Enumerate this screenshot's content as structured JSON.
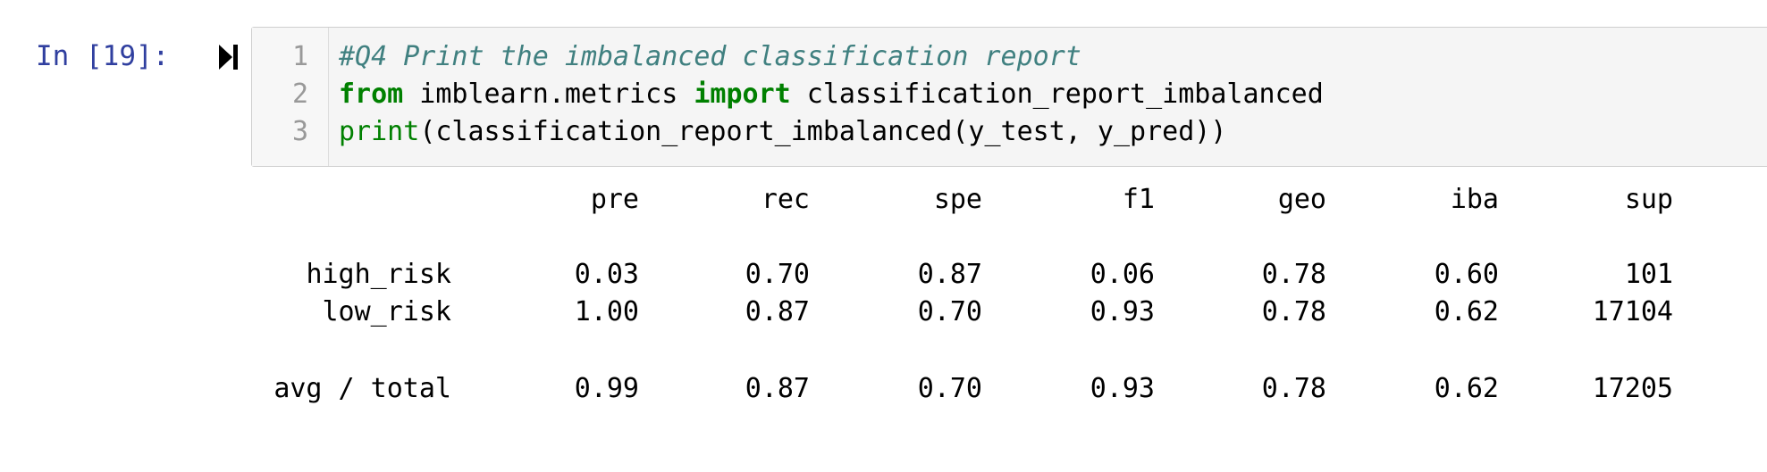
{
  "cell": {
    "prompt": "In [19]:",
    "code_lines": [
      {
        "num": "1",
        "comment": "#Q4 Print the imbalanced classification report"
      },
      {
        "num": "2",
        "kw_from": "from",
        "module": " imblearn.metrics ",
        "kw_import": "import",
        "name": " classification_report_imbalanced"
      },
      {
        "num": "3",
        "builtin": "print",
        "rest": "(classification_report_imbalanced(y_test, y_pred))"
      }
    ]
  },
  "output": {
    "headers": [
      "pre",
      "rec",
      "spe",
      "f1",
      "geo",
      "iba",
      "sup"
    ],
    "rows": [
      {
        "label": "high_risk",
        "values": [
          "0.03",
          "0.70",
          "0.87",
          "0.06",
          "0.78",
          "0.60",
          "101"
        ]
      },
      {
        "label": "low_risk",
        "values": [
          "1.00",
          "0.87",
          "0.70",
          "0.93",
          "0.78",
          "0.62",
          "17104"
        ]
      },
      {
        "label": "avg / total",
        "values": [
          "0.99",
          "0.87",
          "0.70",
          "0.93",
          "0.78",
          "0.62",
          "17205"
        ]
      }
    ]
  }
}
